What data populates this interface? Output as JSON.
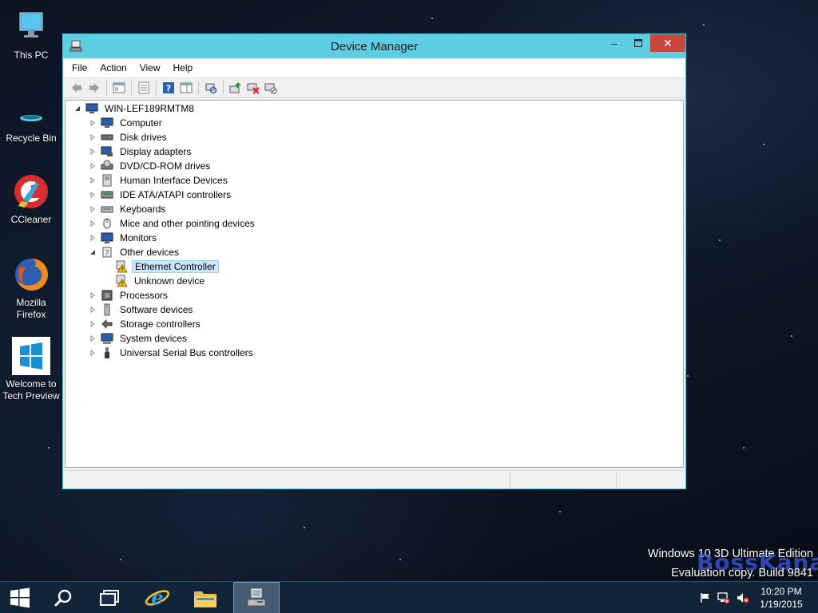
{
  "desktop": {
    "icons": [
      {
        "name": "this-pc",
        "label": "This PC"
      },
      {
        "name": "recycle-bin",
        "label": "Recycle Bin"
      },
      {
        "name": "ccleaner",
        "label": "CCleaner"
      },
      {
        "name": "firefox",
        "label": "Mozilla Firefox"
      },
      {
        "name": "welcome",
        "label": "Welcome to Tech Preview"
      }
    ],
    "watermark": {
      "line1": "Windows 10 3D Ultimate Edition",
      "line2": "Evaluation copy. Build 9841",
      "overlay": "BossKana"
    }
  },
  "window": {
    "title": "Device Manager",
    "menu": [
      "File",
      "Action",
      "View",
      "Help"
    ],
    "tree": {
      "root": "WIN-LEF189RMTM8",
      "categories": [
        {
          "label": "Computer",
          "icon": "computer-icon",
          "expanded": false
        },
        {
          "label": "Disk drives",
          "icon": "disk-drive-icon",
          "expanded": false
        },
        {
          "label": "Display adapters",
          "icon": "display-adapter-icon",
          "expanded": false
        },
        {
          "label": "DVD/CD-ROM drives",
          "icon": "dvd-drive-icon",
          "expanded": false
        },
        {
          "label": "Human Interface Devices",
          "icon": "hid-icon",
          "expanded": false
        },
        {
          "label": "IDE ATA/ATAPI controllers",
          "icon": "ide-controller-icon",
          "expanded": false
        },
        {
          "label": "Keyboards",
          "icon": "keyboard-icon",
          "expanded": false
        },
        {
          "label": "Mice and other pointing devices",
          "icon": "mouse-icon",
          "expanded": false
        },
        {
          "label": "Monitors",
          "icon": "monitor-icon",
          "expanded": false
        },
        {
          "label": "Other devices",
          "icon": "other-devices-icon",
          "expanded": true,
          "children": [
            {
              "label": "Ethernet Controller",
              "icon": "warning-device-icon",
              "selected": true
            },
            {
              "label": "Unknown device",
              "icon": "warning-device-icon",
              "selected": false
            }
          ]
        },
        {
          "label": "Processors",
          "icon": "processor-icon",
          "expanded": false
        },
        {
          "label": "Software devices",
          "icon": "software-device-icon",
          "expanded": false
        },
        {
          "label": "Storage controllers",
          "icon": "storage-controller-icon",
          "expanded": false
        },
        {
          "label": "System devices",
          "icon": "system-device-icon",
          "expanded": false
        },
        {
          "label": "Universal Serial Bus controllers",
          "icon": "usb-icon",
          "expanded": false
        }
      ]
    }
  },
  "taskbar": {
    "time": "10:20 PM",
    "date": "1/19/2015"
  }
}
